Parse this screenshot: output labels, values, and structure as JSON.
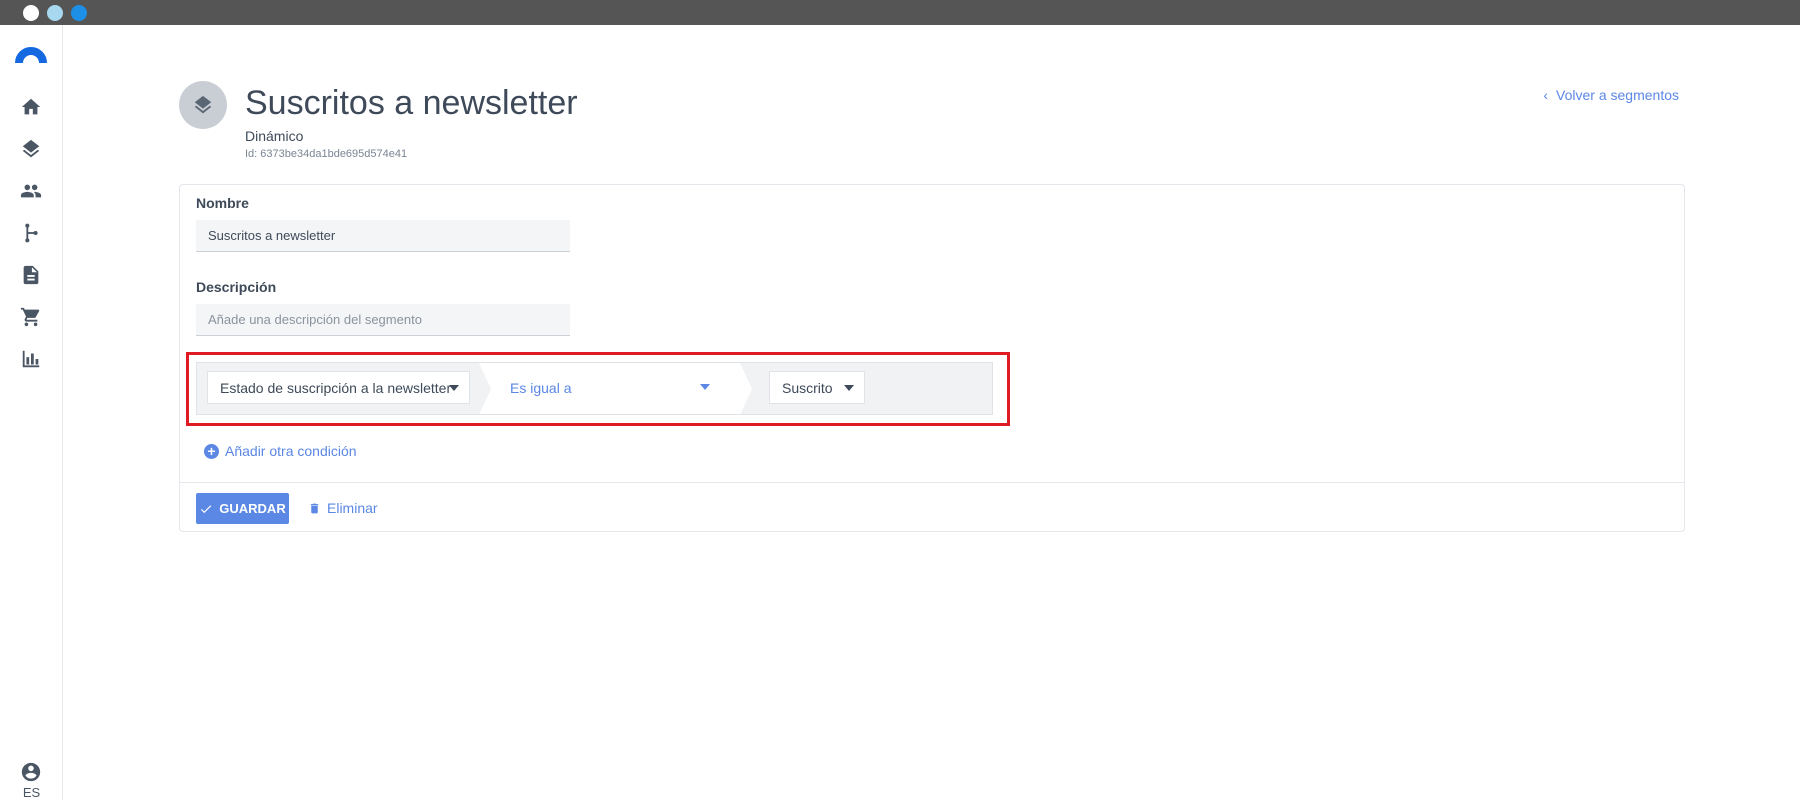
{
  "window": {
    "controls": [
      "close",
      "minimize",
      "maximize"
    ]
  },
  "sidebar": {
    "logo": "brand-logo",
    "items": [
      {
        "icon": "home-icon"
      },
      {
        "icon": "layers-icon"
      },
      {
        "icon": "people-icon"
      },
      {
        "icon": "workflow-icon"
      },
      {
        "icon": "document-icon"
      },
      {
        "icon": "cart-icon"
      },
      {
        "icon": "bar-chart-icon"
      }
    ],
    "account_icon": "account-circle-icon",
    "language": "ES"
  },
  "header": {
    "title": "Suscritos a newsletter",
    "type": "Dinámico",
    "id_text": "Id: 6373be34da1bde695d574e41",
    "back_link": "Volver a segmentos"
  },
  "form": {
    "name_label": "Nombre",
    "name_value": "Suscritos a newsletter",
    "description_label": "Descripción",
    "description_value": "",
    "description_placeholder": "Añade una descripción del segmento",
    "condition": {
      "field": "Estado de suscripción a la newsletter",
      "operator": "Es igual a",
      "value": "Suscrito"
    },
    "add_condition": "Añadir otra condición",
    "save_label": "GUARDAR",
    "delete_label": "Eliminar"
  },
  "colors": {
    "accent": "#5b87e5",
    "highlight": "#e01a22",
    "brand": "#1468e0"
  }
}
